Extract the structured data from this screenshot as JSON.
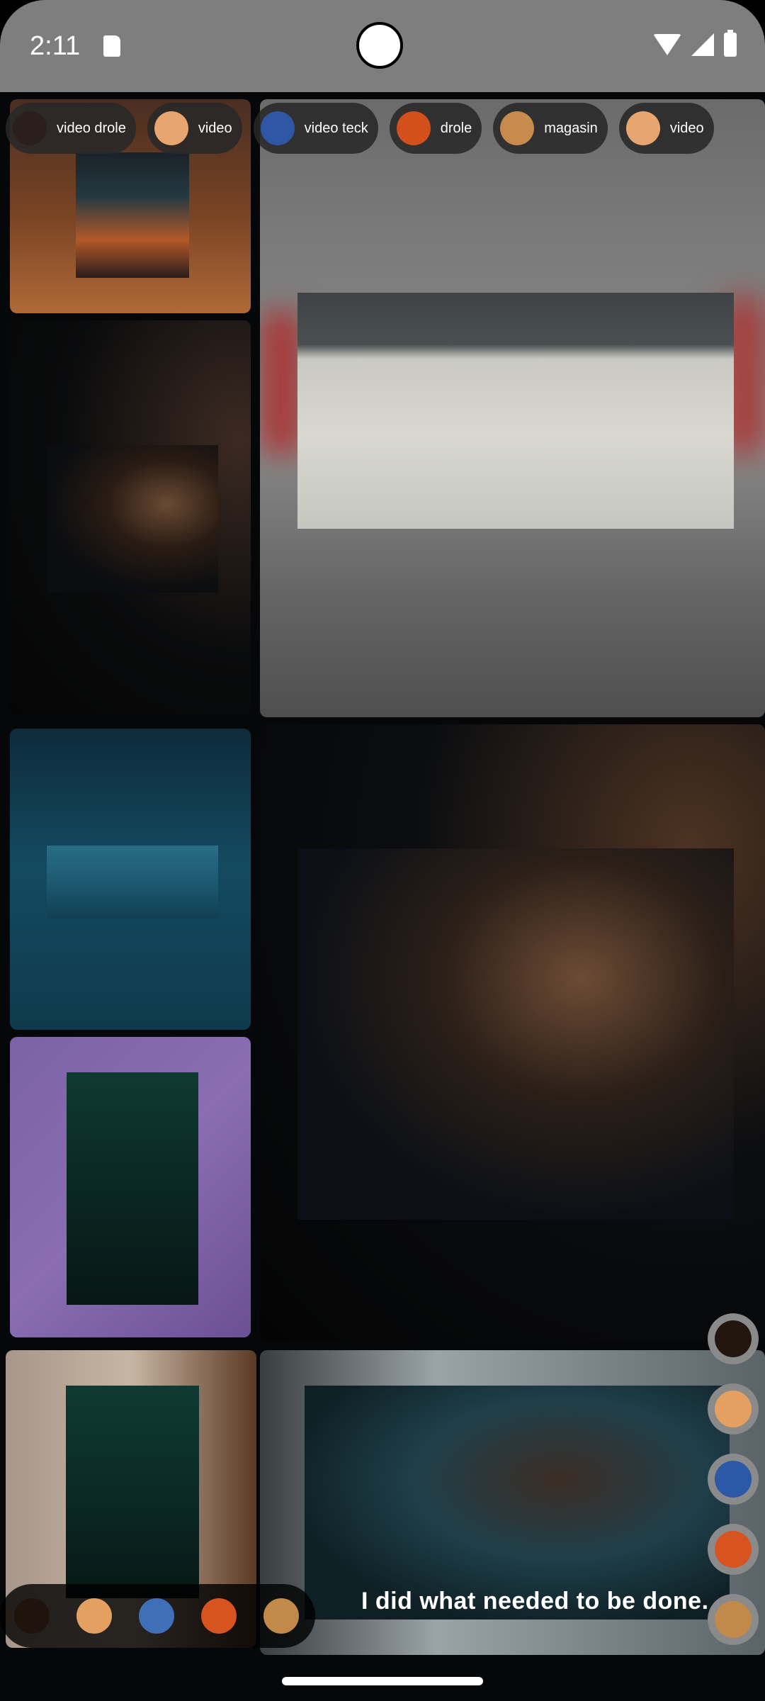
{
  "status": {
    "time": "2:11"
  },
  "chips": [
    {
      "label": "video drole",
      "thumb_color": "#2a1f1a"
    },
    {
      "label": "video",
      "thumb_color": "#e7a66f"
    },
    {
      "label": "video teck",
      "thumb_color": "#2f57a6"
    },
    {
      "label": "drole",
      "thumb_color": "#d3501c"
    },
    {
      "label": "magasin",
      "thumb_color": "#c78b4d"
    },
    {
      "label": "video",
      "thumb_color": "#e7a66f"
    }
  ],
  "caption": {
    "text": "I did what needed to be done."
  },
  "dock": [
    {
      "color": "#1f140d"
    },
    {
      "color": "#e4a060"
    },
    {
      "color": "#3f6fb6"
    },
    {
      "color": "#d7531f"
    },
    {
      "color": "#c28a4a"
    }
  ],
  "rail": [
    {
      "color": "#22160f"
    },
    {
      "color": "#e4a060"
    },
    {
      "color": "#2c58a8"
    },
    {
      "color": "#d7531f"
    },
    {
      "color": "#c28a4a"
    }
  ]
}
